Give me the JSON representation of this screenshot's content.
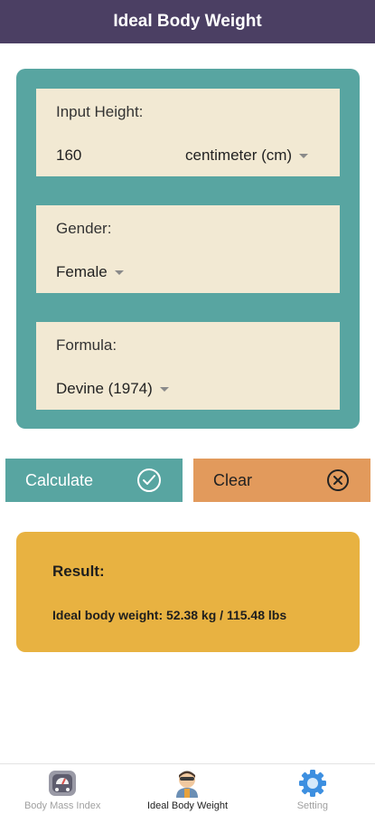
{
  "header": {
    "title": "Ideal Body Weight"
  },
  "form": {
    "height": {
      "label": "Input Height:",
      "value": "160",
      "unit": "centimeter (cm)"
    },
    "gender": {
      "label": "Gender:",
      "value": "Female"
    },
    "formula": {
      "label": "Formula:",
      "value": "Devine (1974)"
    }
  },
  "buttons": {
    "calculate": "Calculate",
    "clear": "Clear"
  },
  "result": {
    "title": "Result:",
    "text": "Ideal body weight: 52.38 kg / 115.48 lbs"
  },
  "tabs": [
    {
      "label": "Body Mass Index",
      "icon": "scale-icon",
      "active": false
    },
    {
      "label": "Ideal Body Weight",
      "icon": "person-icon",
      "active": true
    },
    {
      "label": "Setting",
      "icon": "gear-icon",
      "active": false
    }
  ],
  "colors": {
    "header": "#4b3f63",
    "panel": "#58a5a1",
    "field": "#f2e9d3",
    "calculate": "#58a5a1",
    "clear": "#e29a5c",
    "result": "#e8b241"
  }
}
